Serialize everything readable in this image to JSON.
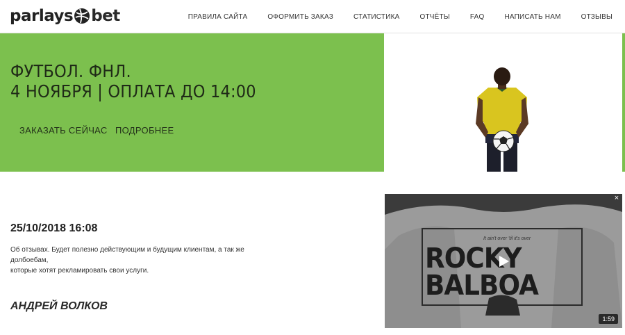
{
  "header": {
    "logo_left": "parlays",
    "logo_right": "bet",
    "nav": [
      "ПРАВИЛА САЙТА",
      "ОФОРМИТЬ ЗАКАЗ",
      "СТАТИСТИКА",
      "ОТЧЁТЫ",
      "FAQ",
      "НАПИСАТЬ НАМ",
      "ОТЗЫВЫ"
    ]
  },
  "hero": {
    "title_line1": "ФУТБОЛ. ФНЛ.",
    "title_line2": "4 НОЯБРЯ | ОПЛАТА ДО 14:00",
    "order_button": "ЗАКАЗАТЬ СЕЙЧАС",
    "more_button": "ПОДРОБНЕЕ"
  },
  "post": {
    "date": "25/10/2018 16:08",
    "text_line1": "Об отзывах. Будет полезно действующим и будущим клиентам, а так же",
    "text_line2": "долбоебам,",
    "text_line3": "которые хотят рекламировать свои услуги.",
    "author": "АНДРЕЙ ВОЛКОВ"
  },
  "video": {
    "shirt_line1": "ROCKY",
    "shirt_line2": "BALBOA",
    "shirt_small": "It ain't over 'til it's over",
    "duration": "1:59",
    "close": "×"
  },
  "colors": {
    "accent_green": "#7cc04e",
    "player_shirt": "#d9c51f"
  }
}
